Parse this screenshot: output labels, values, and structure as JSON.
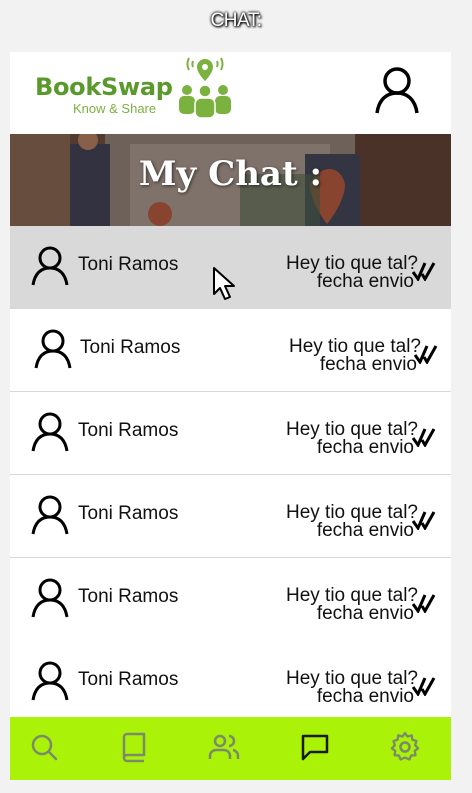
{
  "screen_title": "CHAT:",
  "header": {
    "brand_name": "BookSwap",
    "brand_tagline": "Know & Share",
    "icons": {
      "profile": "user-icon"
    }
  },
  "banner": {
    "title": "My Chat :"
  },
  "chats": [
    {
      "name": "Toni Ramos",
      "message": "Hey tio que tal?",
      "date": "fecha envio",
      "selected": true
    },
    {
      "name": "Toni Ramos",
      "message": "Hey tio que tal?",
      "date": "fecha envio",
      "selected": false
    },
    {
      "name": "Toni Ramos",
      "message": "Hey tio que tal?",
      "date": "fecha envio",
      "selected": false
    },
    {
      "name": "Toni Ramos",
      "message": "Hey tio que tal?",
      "date": "fecha envio",
      "selected": false
    },
    {
      "name": "Toni Ramos",
      "message": "Hey tio que tal?",
      "date": "fecha envio",
      "selected": false
    },
    {
      "name": "Toni Ramos",
      "message": "Hey tio que tal?",
      "date": "fecha envio",
      "selected": false
    }
  ],
  "tabbar": {
    "tabs": [
      "search-icon",
      "book-icon",
      "users-icon",
      "chat-icon",
      "settings-icon"
    ],
    "active": "chat-icon"
  },
  "colors": {
    "brand_green": "#5a9a2c",
    "tabbar": "#aaf208",
    "selected_row": "#d9d9d9"
  }
}
